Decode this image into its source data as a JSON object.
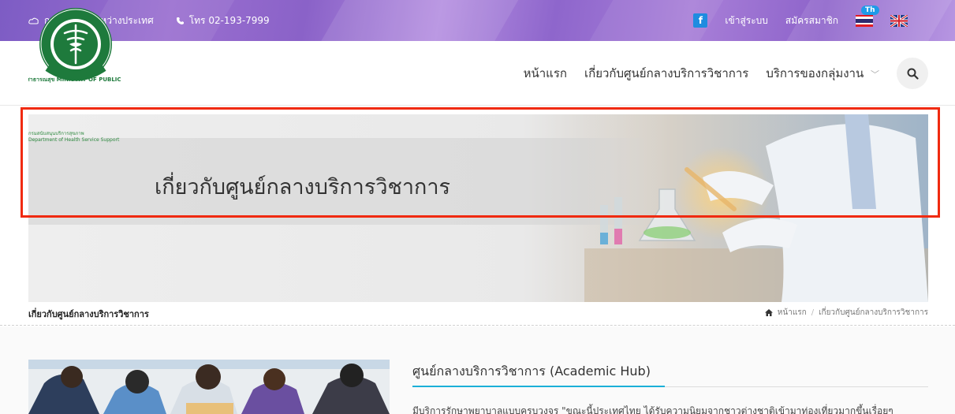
{
  "topbar": {
    "org_label": "กองสุขภาพระหว่างประเทศ",
    "phone_label": "โทร 02-193-7999",
    "facebook_label": "f",
    "login_label": "เข้าสู่ระบบ",
    "register_label": "สมัครสมาชิก",
    "lang_badge": "Th",
    "bg_color": "#8d63ca"
  },
  "header": {
    "logo_ring_text": "กระทรวงสาธารณสุข MINISTRY OF PUBLIC HEALTH",
    "logo_caption_th": "กรมสนับสนุนบริการสุขภาพ",
    "logo_caption_en": "Department of Health Service Support",
    "nav": {
      "home": "หน้าแรก",
      "about": "เกี่ยวกับศูนย์กลางบริการวิชาการ",
      "services": "บริการของกลุ่มงาน",
      "services_chevron": "﹀"
    },
    "search_icon": "search-icon"
  },
  "banner": {
    "title": "เกี่ยวกับศูนย์กลางบริการวิชาการ",
    "highlight_color": "#f02a10"
  },
  "breadcrumb": {
    "page_title": "เกี่ยวกับศูนย์กลางบริการวิชาการ",
    "home": "หน้าแรก",
    "separator": "/",
    "current": "เกี่ยวกับศูนย์กลางบริการวิชาการ"
  },
  "content": {
    "section_title": "ศูนย์กลางบริการวิชาการ (Academic Hub)",
    "paragraph": "มีบริการรักษาพยาบาลแบบครบวงจร \"ขณะนี้ประเทศไทย ได้รับความนิยมจากชาวต่างชาติเข้ามาท่องเที่ยวมากขึ้นเรื่อยๆ",
    "accent_color": "#1bb0d8"
  }
}
